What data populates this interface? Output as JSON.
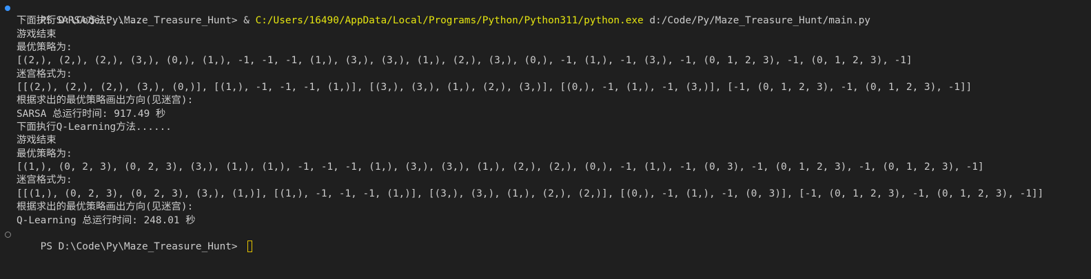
{
  "terminal": {
    "command": {
      "prompt": "PS D:\\Code\\Py\\Maze_Treasure_Hunt> ",
      "amp": "& ",
      "exe": "C:/Users/16490/AppData/Local/Programs/Python/Python311/python.exe",
      "arg": " d:/Code/Py/Maze_Treasure_Hunt/main.py"
    },
    "lines": [
      "下面执行SARSA方法......",
      "游戏结束",
      "最优策略为:",
      "[(2,), (2,), (2,), (3,), (0,), (1,), -1, -1, -1, (1,), (3,), (3,), (1,), (2,), (3,), (0,), -1, (1,), -1, (3,), -1, (0, 1, 2, 3), -1, (0, 1, 2, 3), -1]",
      "迷宫格式为:",
      "[[(2,), (2,), (2,), (3,), (0,)], [(1,), -1, -1, -1, (1,)], [(3,), (3,), (1,), (2,), (3,)], [(0,), -1, (1,), -1, (3,)], [-1, (0, 1, 2, 3), -1, (0, 1, 2, 3), -1]]",
      "根据求出的最优策略画出方向(见迷宫):",
      "SARSA 总运行时间: 917.49 秒",
      "下面执行Q-Learning方法......",
      "游戏结束",
      "最优策略为:",
      "[(1,), (0, 2, 3), (0, 2, 3), (3,), (1,), (1,), -1, -1, -1, (1,), (3,), (3,), (1,), (2,), (2,), (0,), -1, (1,), -1, (0, 3), -1, (0, 1, 2, 3), -1, (0, 1, 2, 3), -1]",
      "迷宫格式为:",
      "[[(1,), (0, 2, 3), (0, 2, 3), (3,), (1,)], [(1,), -1, -1, -1, (1,)], [(3,), (3,), (1,), (2,), (2,)], [(0,), -1, (1,), -1, (0, 3)], [-1, (0, 1, 2, 3), -1, (0, 1, 2, 3), -1]]",
      "根据求出的最优策略画出方向(见迷宫):",
      "Q-Learning 总运行时间: 248.01 秒"
    ],
    "final_prompt": "PS D:\\Code\\Py\\Maze_Treasure_Hunt> ",
    "colors": {
      "background": "#1f1f1f",
      "text": "#cccccc",
      "exe_path": "#e5e510",
      "success_dot": "#3794ff",
      "cursor": "#e5c400"
    }
  }
}
